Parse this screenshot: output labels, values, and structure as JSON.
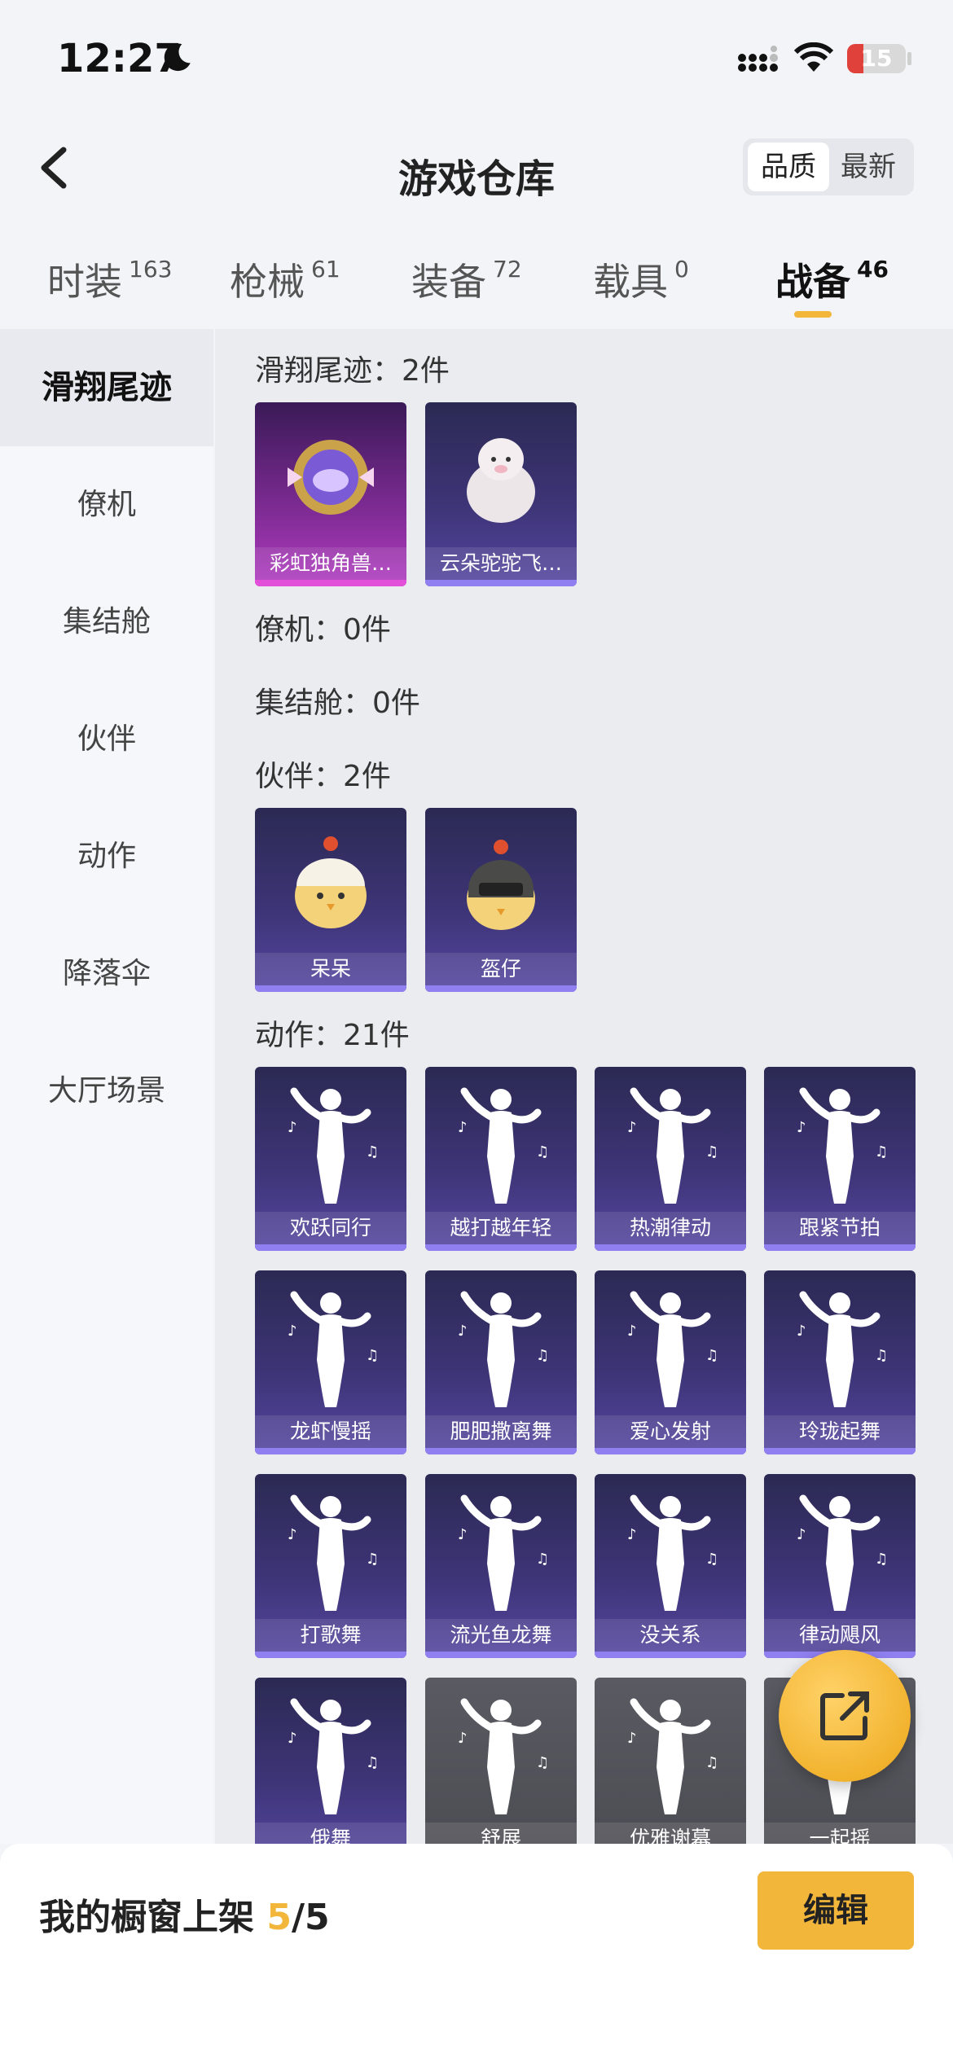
{
  "status_bar": {
    "time": "12:27",
    "battery": "15"
  },
  "header": {
    "title": "游戏仓库",
    "sort": {
      "quality": "品质",
      "newest": "最新"
    }
  },
  "tabs": [
    {
      "label": "时装",
      "count": "163"
    },
    {
      "label": "枪械",
      "count": "61"
    },
    {
      "label": "装备",
      "count": "72"
    },
    {
      "label": "载具",
      "count": "0"
    },
    {
      "label": "战备",
      "count": "46"
    }
  ],
  "sidebar": [
    "滑翔尾迹",
    "僚机",
    "集结舱",
    "伙伴",
    "动作",
    "降落伞",
    "大厅场景"
  ],
  "sections": {
    "glide": "滑翔尾迹：2件",
    "wingman": "僚机：0件",
    "capsule": "集结舱：0件",
    "companion": "伙伴：2件",
    "emote": "动作：21件"
  },
  "glide_items": [
    "彩虹独角兽…",
    "云朵驼驼飞…"
  ],
  "companion_items": [
    "呆呆",
    "盔仔"
  ],
  "emote_items": [
    "欢跃同行",
    "越打越年轻",
    "热潮律动",
    "跟紧节拍",
    "龙虾慢摇",
    "肥肥撒离舞",
    "爱心发射",
    "玲珑起舞",
    "打歌舞",
    "流光鱼龙舞",
    "没关系",
    "律动飓风",
    "俄舞",
    "舒展",
    "优雅谢幕",
    "一起摇"
  ],
  "bottom": {
    "label": "我的橱窗上架",
    "on": "5",
    "sep": "/",
    "total": "5",
    "edit": "编辑"
  },
  "colors": {
    "accent": "#f2b63b",
    "card": "#3d3476",
    "card_pink": "#b13bc0"
  }
}
